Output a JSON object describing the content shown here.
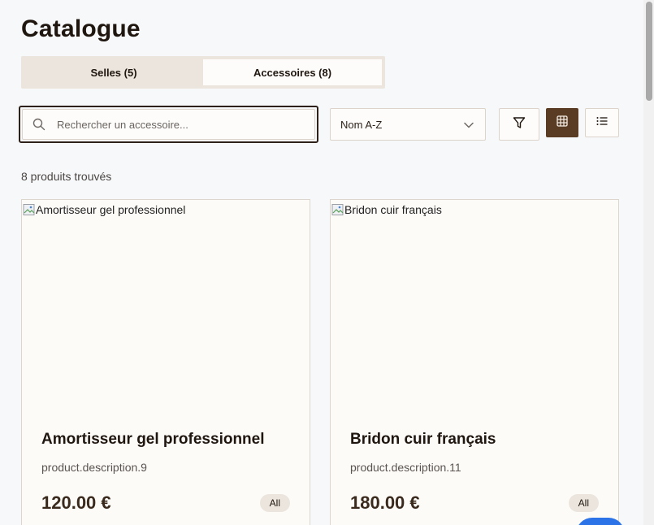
{
  "page": {
    "title": "Catalogue"
  },
  "tabs": [
    {
      "label": "Selles (5)",
      "active": false
    },
    {
      "label": "Accessoires (8)",
      "active": true
    }
  ],
  "search": {
    "placeholder": "Rechercher un accessoire...",
    "value": ""
  },
  "sort": {
    "selected": "Nom A-Z"
  },
  "results": {
    "count_text": "8 produits trouvés"
  },
  "products": [
    {
      "image_alt": "Amortisseur gel professionnel",
      "name": "Amortisseur gel professionnel",
      "description": "product.description.9",
      "price": "120.00 €",
      "badge": "All"
    },
    {
      "image_alt": "Bridon cuir français",
      "name": "Bridon cuir français",
      "description": "product.description.11",
      "price": "180.00 €",
      "badge": "All"
    }
  ],
  "icons": {
    "search": "search-icon",
    "sort_chevron": "chevron-down-icon",
    "filter": "filter-icon",
    "grid": "grid-icon",
    "list": "list-icon"
  },
  "colors": {
    "accent": "#5a3c25",
    "background": "#f7f8fa",
    "card": "#fcfbf8",
    "tab_track": "#ebe5dd",
    "chat_button": "#2b73e6"
  }
}
